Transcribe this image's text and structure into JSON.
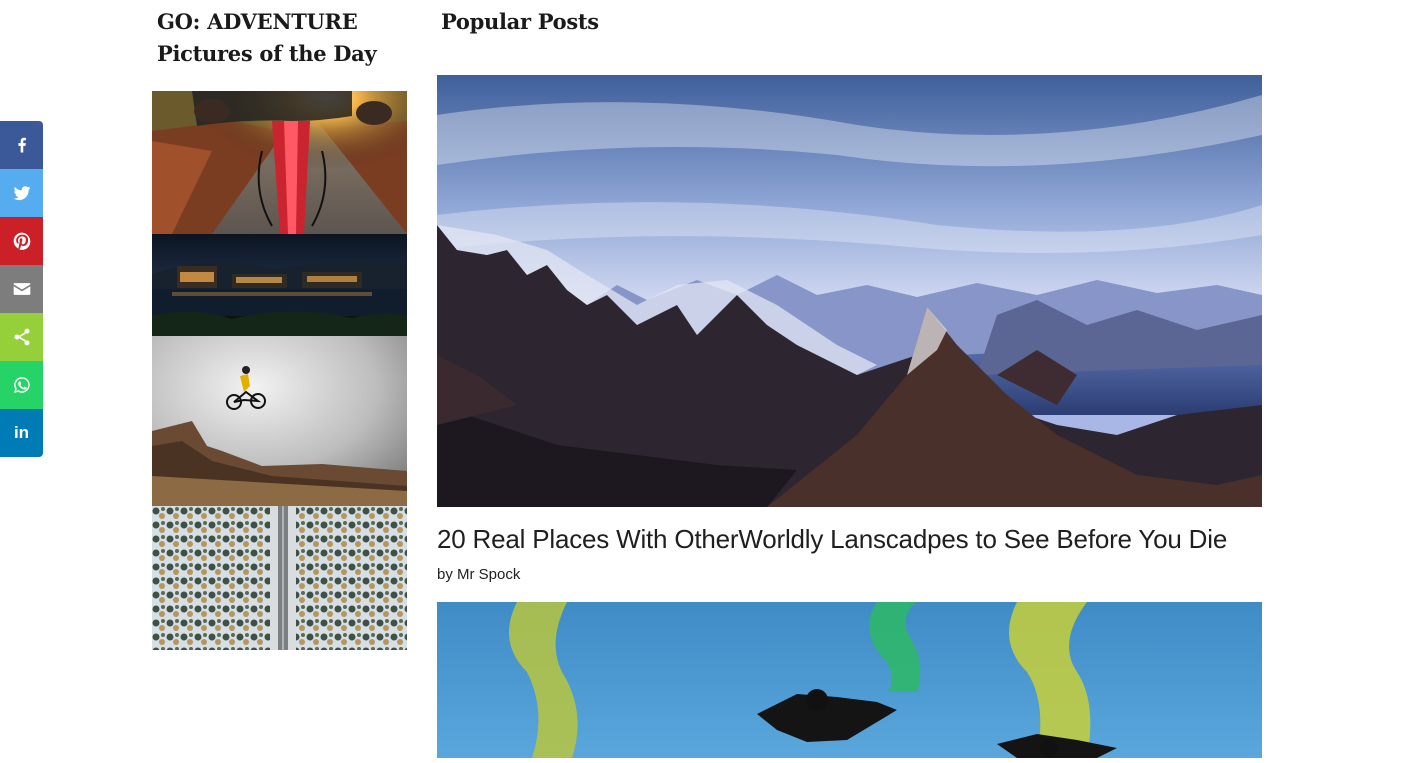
{
  "share_bar": {
    "buttons": [
      {
        "name": "facebook",
        "icon": "facebook-icon",
        "color": "#3b5998"
      },
      {
        "name": "twitter",
        "icon": "twitter-icon",
        "color": "#55acee"
      },
      {
        "name": "pinterest",
        "icon": "pinterest-icon",
        "color": "#cb2027"
      },
      {
        "name": "email",
        "icon": "email-icon",
        "color": "#7d7d7d"
      },
      {
        "name": "share",
        "icon": "share-icon",
        "color": "#95d03a"
      },
      {
        "name": "whatsapp",
        "icon": "whatsapp-icon",
        "color": "#25d366"
      },
      {
        "name": "linkedin",
        "icon": "linkedin-icon",
        "color": "#007bb6",
        "label": "in"
      }
    ]
  },
  "sidebar": {
    "title_line1": "GO: ADVENTURE",
    "title_line2": "Pictures of the Day"
  },
  "main": {
    "heading": "Popular Posts",
    "posts": [
      {
        "title": "20 Real Places With OtherWorldly Lanscadpes to See Before You Die",
        "byline": "by Mr Spock"
      }
    ]
  }
}
